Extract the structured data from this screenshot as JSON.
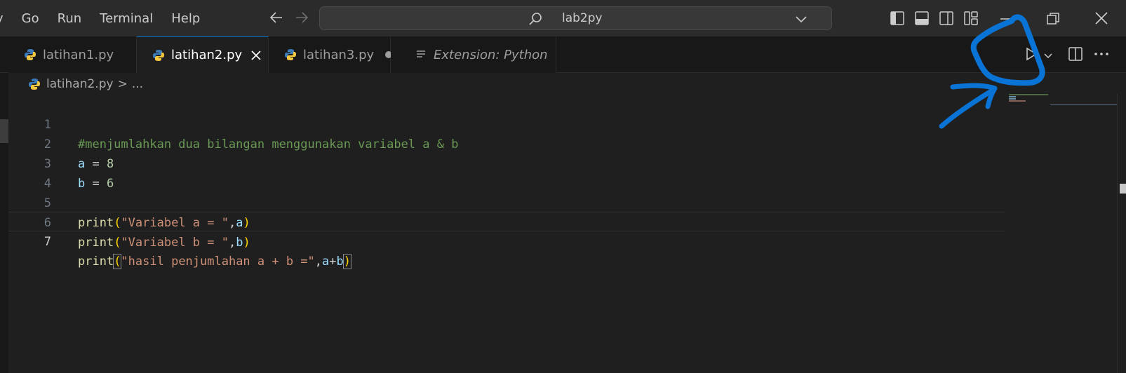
{
  "menu": {
    "items": [
      {
        "label": "y"
      },
      {
        "label": "Go"
      },
      {
        "label": "Run"
      },
      {
        "label": "Terminal"
      },
      {
        "label": "Help"
      }
    ]
  },
  "command_center": {
    "label": "lab2py"
  },
  "tabs": [
    {
      "label": "latihan1.py",
      "icon": "python-icon",
      "state": "inactive"
    },
    {
      "label": "latihan2.py",
      "icon": "python-icon",
      "state": "active",
      "action": "close-icon"
    },
    {
      "label": "latihan3.py",
      "icon": "python-icon",
      "state": "modified",
      "action": "dot-icon"
    },
    {
      "label": "Extension: Python",
      "icon": "extension-list-icon",
      "state": "preview"
    }
  ],
  "breadcrumb": {
    "file": "latihan2.py",
    "separator": ">",
    "more": "..."
  },
  "editor": {
    "lines": [
      {
        "number": "1",
        "text": "#menjumlahkan dua bilangan menggunakan variabel a & b"
      },
      {
        "number": "2",
        "text": "a = 8"
      },
      {
        "number": "3",
        "text": "b = 6"
      },
      {
        "number": "4",
        "text": ""
      },
      {
        "number": "5",
        "text": "print(\"Variabel a = \",a)"
      },
      {
        "number": "6",
        "text": "print(\"Variabel b = \",b)"
      },
      {
        "number": "7",
        "text": "print(\"hasil penjumlahan a + b =\",a+b)"
      }
    ],
    "current_line": "7"
  },
  "icons": {
    "back": "arrow-left-icon",
    "forward": "arrow-right-icon",
    "search": "search-icon",
    "dropdown": "chevron-down-icon",
    "run": "run-python-file-icon",
    "split": "split-editor-icon",
    "more": "more-actions-icon",
    "minimize": "minimize-icon",
    "restore": "restore-icon",
    "close": "close-window-icon"
  },
  "colors": {
    "titlebar": "#2b2b2b",
    "editor_bg": "#1f1f1f",
    "tabbar_bg": "#181818",
    "annotation": "#0a74d6",
    "comment": "#6a9955",
    "string": "#ce9178",
    "function": "#dcdcaa",
    "variable": "#9cdcfe",
    "number": "#b5cea8"
  }
}
